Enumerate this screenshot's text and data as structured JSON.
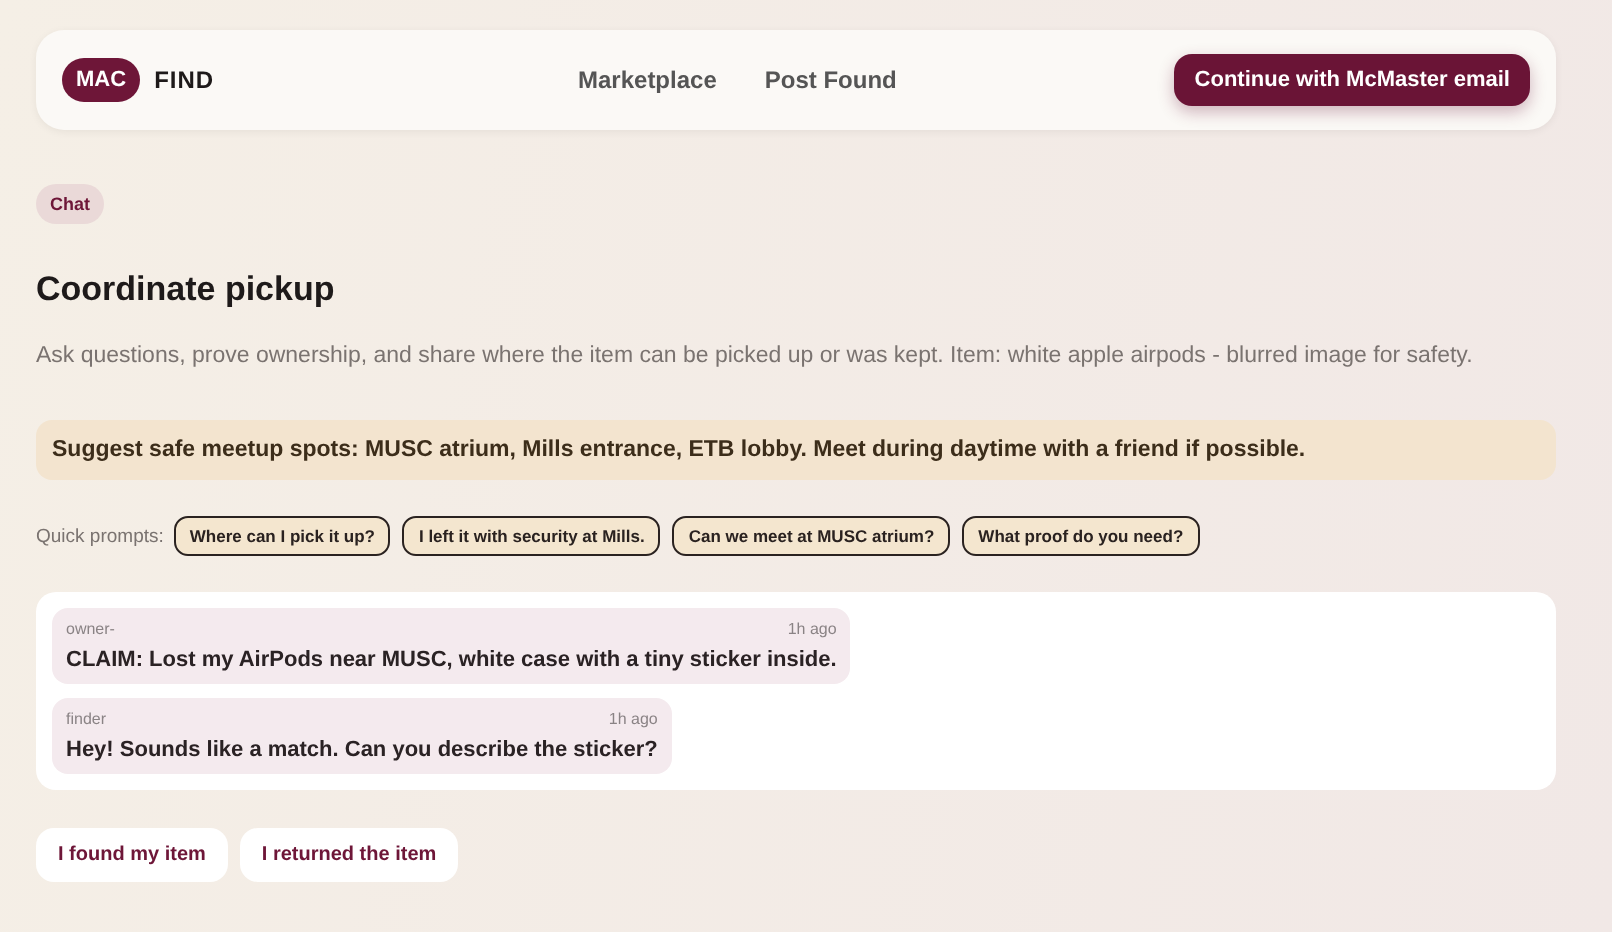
{
  "header": {
    "logo_badge": "MAC",
    "logo_text": "FIND",
    "nav": [
      "Marketplace",
      "Post Found"
    ],
    "cta": "Continue with McMaster email"
  },
  "tag": "Chat",
  "title": "Coordinate pickup",
  "description": "Ask questions, prove ownership, and share where the item can be picked up or was kept. Item: white apple airpods - blurred image for safety.",
  "notice": "Suggest safe meetup spots: MUSC atrium, Mills entrance, ETB lobby. Meet during daytime with a friend if possible.",
  "quick_prompts": {
    "label": "Quick prompts:",
    "items": [
      "Where can I pick it up?",
      "I left it with security at Mills.",
      "Can we meet at MUSC atrium?",
      "What proof do you need?"
    ]
  },
  "messages": [
    {
      "sender": "owner-",
      "time": "1h ago",
      "text": "CLAIM: Lost my AirPods near MUSC, white case with a tiny sticker inside."
    },
    {
      "sender": "finder",
      "time": "1h ago",
      "text": "Hey! Sounds like a match. Can you describe the sticker?"
    }
  ],
  "actions": [
    "I found my item",
    "I returned the item"
  ]
}
